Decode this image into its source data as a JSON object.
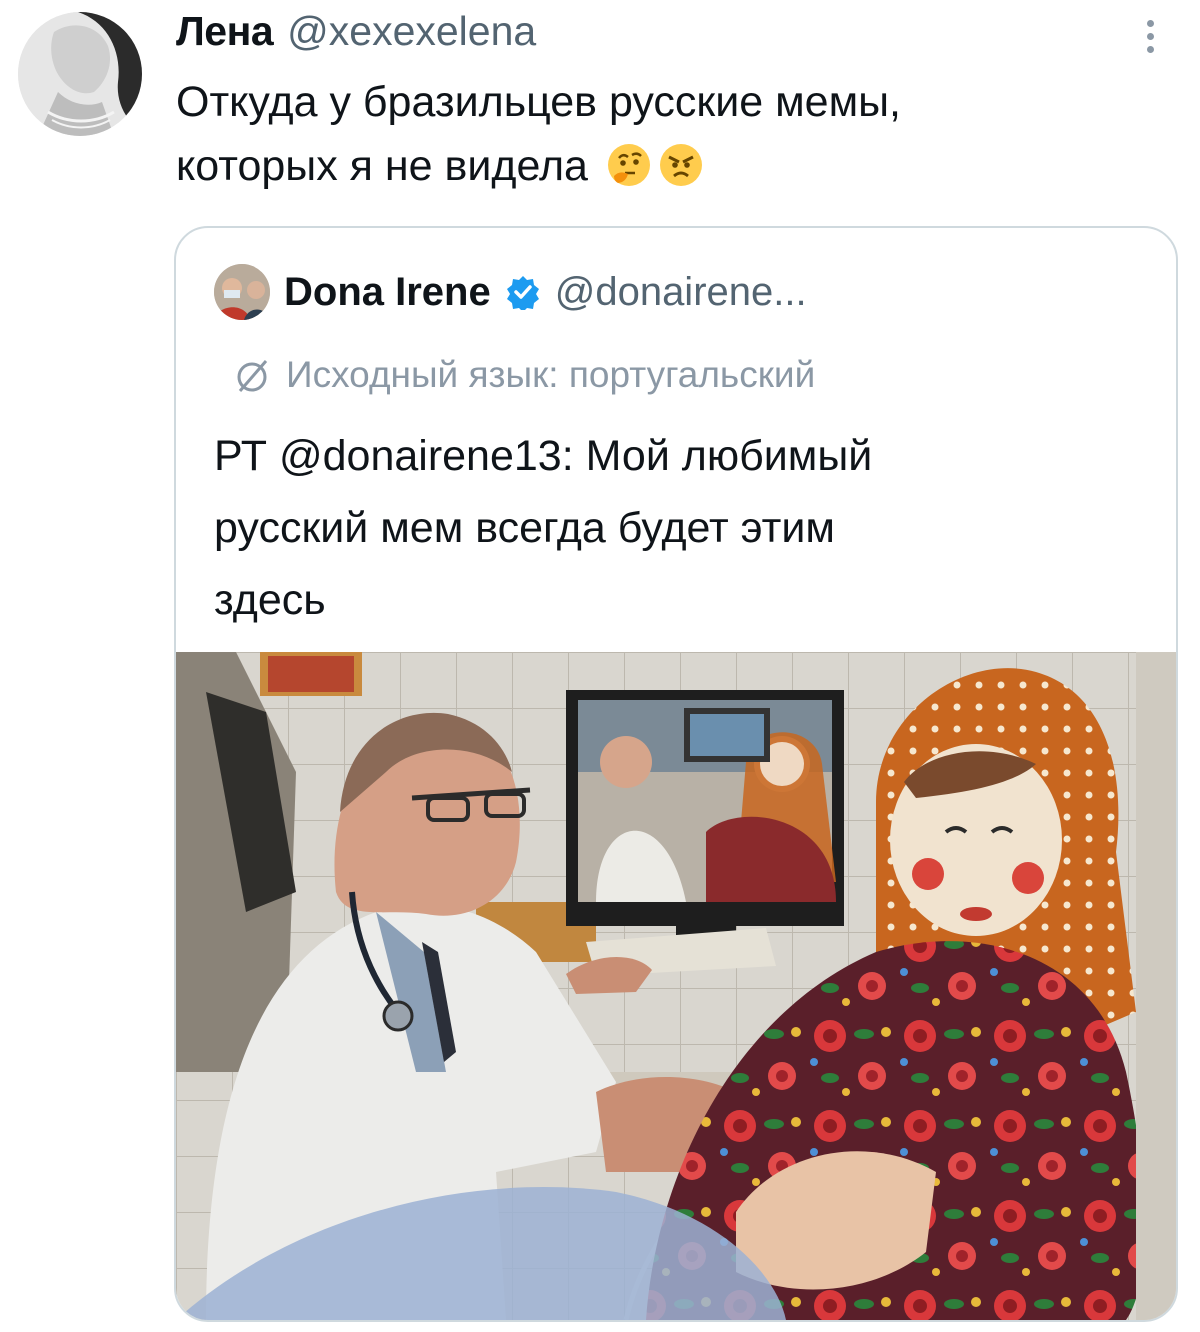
{
  "tweet": {
    "author_name": "Лена",
    "author_handle": "@xexexelena",
    "text_line1": "Откуда у бразильцев русские мемы,",
    "text_line2": "которых я не видела",
    "emojis": [
      "thinking-face",
      "angry-face"
    ]
  },
  "quoted_tweet": {
    "author_name": "Dona Irene",
    "verified": true,
    "author_handle": "@donairene...",
    "translated_from": "Исходный язык: португальский",
    "text_line1": "РТ @donairene13: Мой любимый",
    "text_line2": "русский мем всегда будет этим",
    "text_line3": "здесь"
  },
  "colors": {
    "text_primary": "#0f1419",
    "text_secondary": "#536471",
    "border": "#cfd9de",
    "verified_blue": "#1d9bf0"
  }
}
